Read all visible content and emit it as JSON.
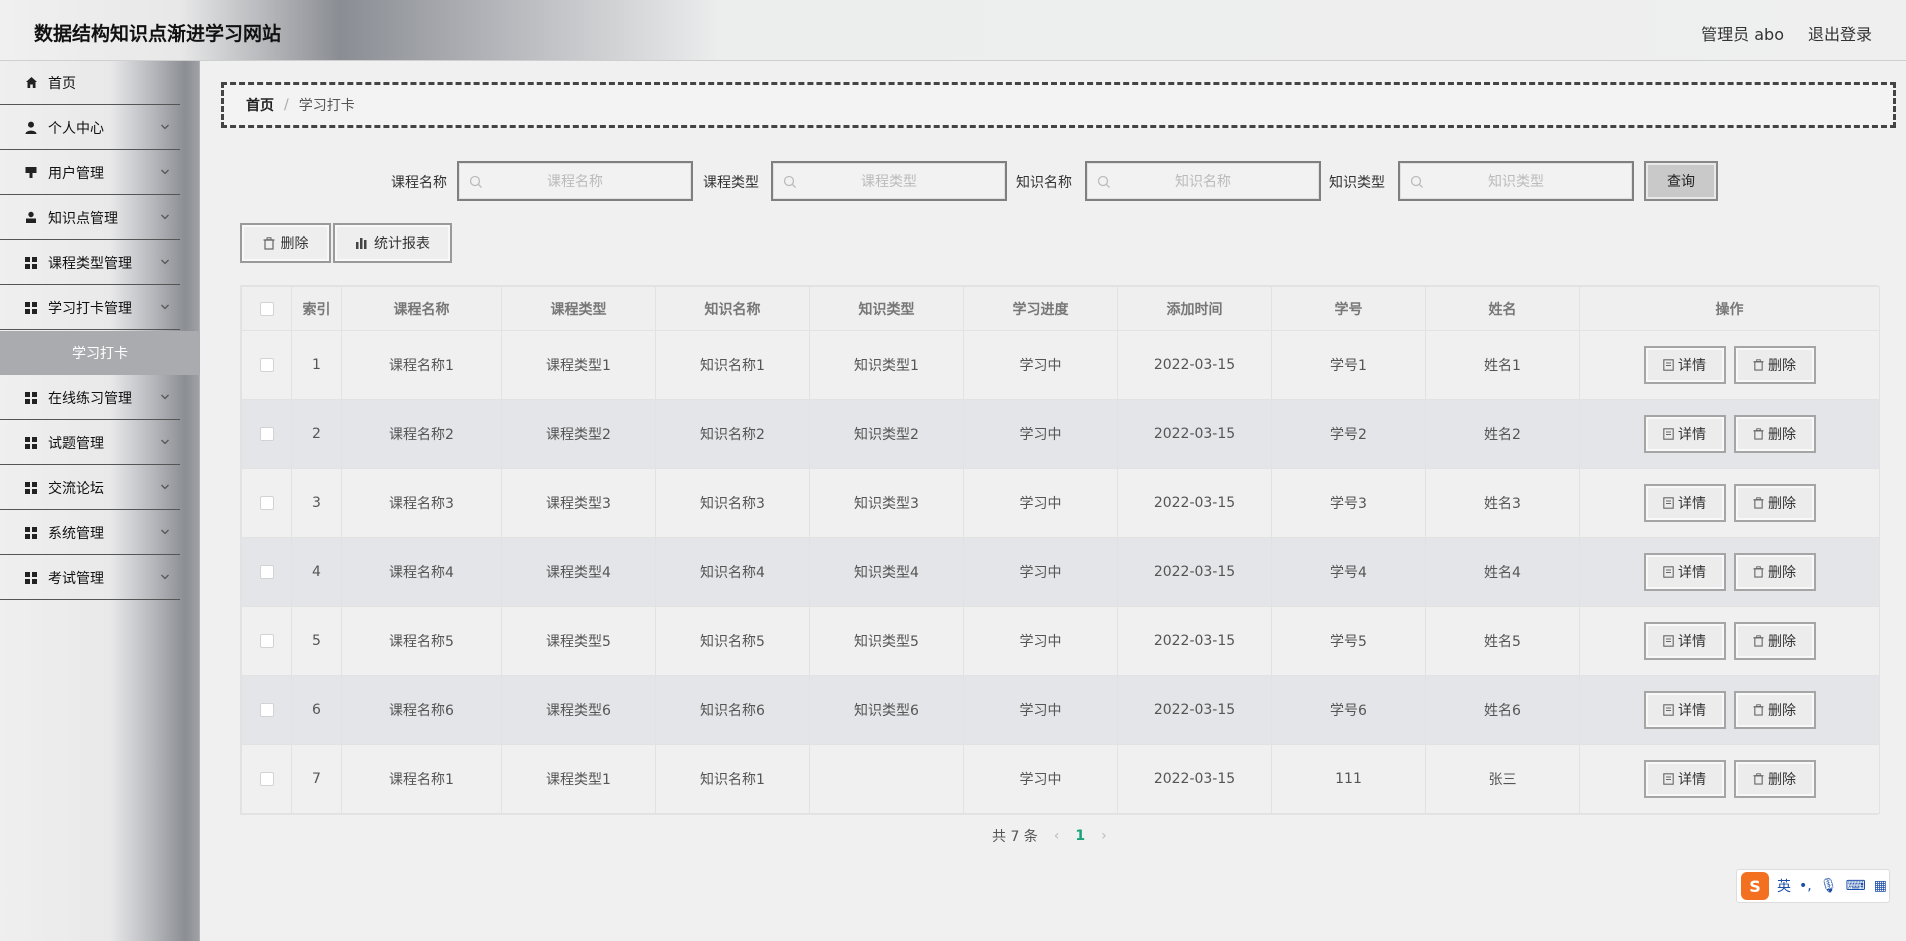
{
  "header": {
    "title": "数据结构知识点渐进学习网站",
    "user_label": "管理员 abo",
    "logout_label": "退出登录"
  },
  "sidebar": {
    "items": [
      {
        "label": "首页",
        "icon": "home-icon"
      },
      {
        "label": "个人中心",
        "icon": "user-icon"
      },
      {
        "label": "用户管理",
        "icon": "user-manage-icon"
      },
      {
        "label": "知识点管理",
        "icon": "knowledge-icon"
      },
      {
        "label": "课程类型管理",
        "icon": "grid-icon"
      },
      {
        "label": "学习打卡管理",
        "icon": "grid-icon"
      },
      {
        "label": "在线练习管理",
        "icon": "grid-icon"
      },
      {
        "label": "试题管理",
        "icon": "grid-icon"
      },
      {
        "label": "交流论坛",
        "icon": "grid-icon"
      },
      {
        "label": "系统管理",
        "icon": "grid-icon"
      },
      {
        "label": "考试管理",
        "icon": "grid-icon"
      }
    ],
    "active_sub": "学习打卡"
  },
  "breadcrumb": {
    "home": "首页",
    "sep": "/",
    "current": "学习打卡"
  },
  "search": {
    "course_name_label": "课程名称",
    "course_name_placeholder": "课程名称",
    "course_type_label": "课程类型",
    "course_type_placeholder": "课程类型",
    "knowledge_name_label": "知识名称",
    "knowledge_name_placeholder": "知识名称",
    "knowledge_type_label": "知识类型",
    "knowledge_type_placeholder": "知识类型",
    "query_label": "查询"
  },
  "toolbar": {
    "delete_label": "删除",
    "report_label": "统计报表"
  },
  "table": {
    "headers": [
      "索引",
      "课程名称",
      "课程类型",
      "知识名称",
      "知识类型",
      "学习进度",
      "添加时间",
      "学号",
      "姓名",
      "操作"
    ],
    "rows": [
      [
        "1",
        "课程名称1",
        "课程类型1",
        "知识名称1",
        "知识类型1",
        "学习中",
        "2022-03-15",
        "学号1",
        "姓名1"
      ],
      [
        "2",
        "课程名称2",
        "课程类型2",
        "知识名称2",
        "知识类型2",
        "学习中",
        "2022-03-15",
        "学号2",
        "姓名2"
      ],
      [
        "3",
        "课程名称3",
        "课程类型3",
        "知识名称3",
        "知识类型3",
        "学习中",
        "2022-03-15",
        "学号3",
        "姓名3"
      ],
      [
        "4",
        "课程名称4",
        "课程类型4",
        "知识名称4",
        "知识类型4",
        "学习中",
        "2022-03-15",
        "学号4",
        "姓名4"
      ],
      [
        "5",
        "课程名称5",
        "课程类型5",
        "知识名称5",
        "知识类型5",
        "学习中",
        "2022-03-15",
        "学号5",
        "姓名5"
      ],
      [
        "6",
        "课程名称6",
        "课程类型6",
        "知识名称6",
        "知识类型6",
        "学习中",
        "2022-03-15",
        "学号6",
        "姓名6"
      ],
      [
        "7",
        "课程名称1",
        "课程类型1",
        "知识名称1",
        "",
        "学习中",
        "2022-03-15",
        "111",
        "张三"
      ]
    ],
    "detail_label": "详情",
    "delete_label": "删除"
  },
  "pagination": {
    "total_text": "共 7 条",
    "current_page": "1",
    "prev": "‹",
    "next": "›"
  },
  "ime": {
    "logo": "S",
    "lang": "英",
    "punct": "•,",
    "mic": "🎙",
    "keyboard": "⌨",
    "menu": "▦"
  },
  "colors": {
    "accent": "#1aa37a",
    "ime_orange": "#f37021"
  }
}
